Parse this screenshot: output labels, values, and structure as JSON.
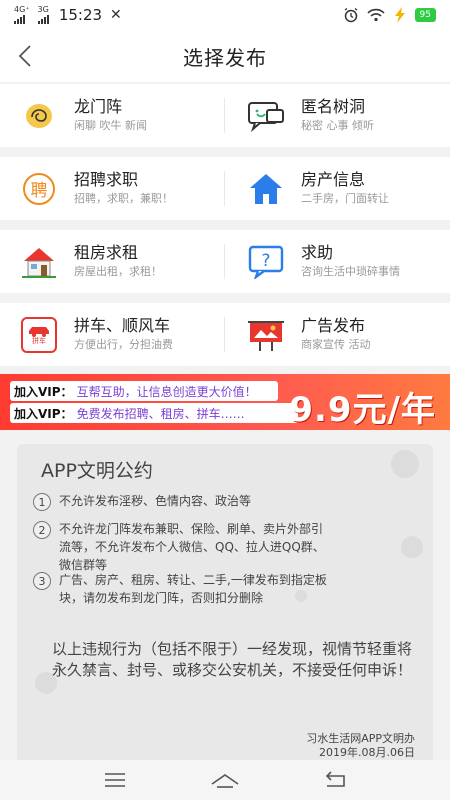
{
  "status": {
    "network1": "4G⁺",
    "network2": "3G",
    "time": "15:23",
    "battery": "95"
  },
  "header": {
    "title": "选择发布"
  },
  "categories": [
    {
      "title": "龙门阵",
      "subtitle": "闲聊 吹牛 新闻",
      "icon": "chat-bubble-icon"
    },
    {
      "title": "匿名树洞",
      "subtitle": "秘密 心事 倾听",
      "icon": "anonymous-chat-icon"
    },
    {
      "title": "招聘求职",
      "subtitle": "招聘，求职，兼职！",
      "icon": "recruit-icon",
      "icon_text": "聘"
    },
    {
      "title": "房产信息",
      "subtitle": "二手房，门面转让",
      "icon": "house-icon"
    },
    {
      "title": "租房求租",
      "subtitle": "房屋出租，求租！",
      "icon": "rent-house-icon"
    },
    {
      "title": "求助",
      "subtitle": "咨询生活中琐碎事情",
      "icon": "help-question-icon"
    },
    {
      "title": "拼车、顺风车",
      "subtitle": "方便出行，分担油费",
      "icon": "carpool-icon",
      "icon_text": "拼车"
    },
    {
      "title": "广告发布",
      "subtitle": "商家宣传 活动",
      "icon": "billboard-icon"
    }
  ],
  "banner": {
    "line1_label": "加入VIP：",
    "line1_text": "互帮互助，让信息创造更大价值！",
    "line2_label": "加入VIP：",
    "line2_text": "免费发布招聘、租房、拼车……",
    "price": "9.9元/年"
  },
  "pact": {
    "title": "APP文明公约",
    "rules": [
      {
        "num": "1",
        "text": "不允许发布淫秽、色情内容、政治等"
      },
      {
        "num": "2",
        "text": "不允许龙门阵发布兼职、保险、刷单、卖片外部引流等，不允许发布个人微信、QQ、拉人进QQ群、微信群等"
      },
      {
        "num": "3",
        "text": "广告、房产、租房、转让、二手,一律发布到指定板块，请勿发布到龙门阵，否则扣分删除"
      }
    ],
    "warning": "以上违规行为（包括不限于）一经发现，视情节轻重将永久禁言、封号、或移交公安机关，不接受任何申诉！",
    "signature": "习水生活网APP文明办",
    "date": "2019年.08月.06日"
  },
  "colors": {
    "accent_blue": "#2b7de9",
    "accent_orange": "#f08a1c",
    "accent_red": "#e8362f",
    "banner_red": "#ff3b30",
    "battery_green": "#2ecc40"
  }
}
